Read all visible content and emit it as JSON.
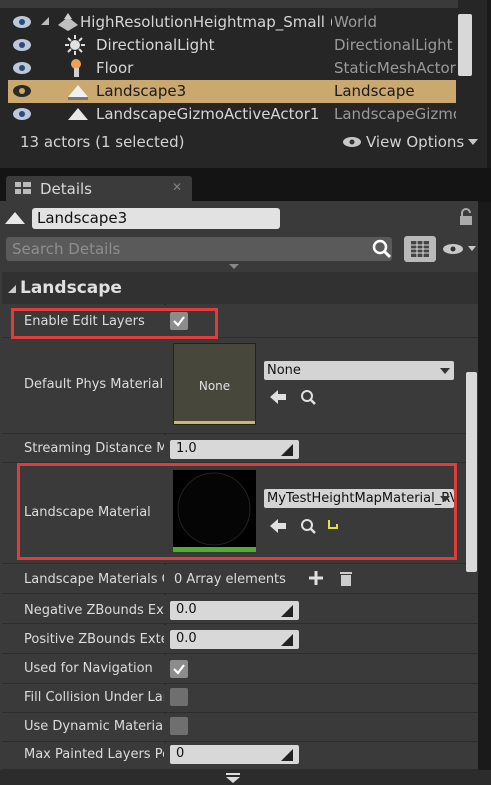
{
  "outliner": {
    "rows": [
      {
        "label": "HighResolutionHeightmap_Small (Ed",
        "type": "World"
      },
      {
        "label": "DirectionalLight",
        "type": "DirectionalLight"
      },
      {
        "label": "Floor",
        "type": "StaticMeshActor"
      },
      {
        "label": "Landscape3",
        "type": "Landscape"
      },
      {
        "label": "LandscapeGizmoActiveActor1",
        "type": "LandscapeGizmo"
      }
    ],
    "count": "13 actors (1 selected)",
    "view_options": "View Options"
  },
  "details": {
    "tab": "Details",
    "actor_name": "Landscape3",
    "search_placeholder": "Search Details",
    "category": "Landscape",
    "props": {
      "enable_edit_layers": "Enable Edit Layers",
      "default_phys": "Default Phys Material",
      "default_phys_value": "None",
      "default_phys_thumb": "None",
      "streaming": "Streaming Distance Mult",
      "streaming_value": "1.0",
      "landscape_material": "Landscape Material",
      "landscape_material_value": "MyTestHeightMapMaterial_RV",
      "materials_override": "Landscape Materials Ov",
      "materials_override_value": "0 Array elements",
      "neg_z": "Negative ZBounds Exten",
      "neg_z_value": "0.0",
      "pos_z": "Positive ZBounds Extens",
      "pos_z_value": "0.0",
      "nav": "Used for Navigation",
      "fill_collision": "Fill Collision Under Lands",
      "dyn_material": "Use Dynamic Material In",
      "max_painted": "Max Painted Layers Per",
      "max_painted_value": "0"
    }
  }
}
